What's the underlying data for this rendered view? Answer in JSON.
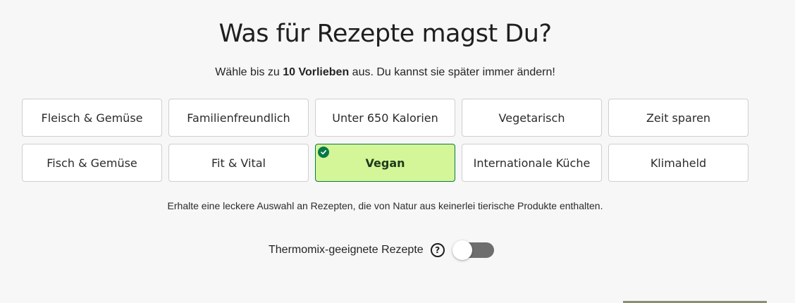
{
  "heading": "Was für Rezepte magst Du?",
  "subtitle": {
    "prefix": "Wähle bis zu ",
    "highlight": "10 Vorlieben",
    "suffix": " aus. Du kannst sie später immer ändern!"
  },
  "preferences": [
    {
      "label": "Fleisch & Gemüse",
      "selected": false
    },
    {
      "label": "Familienfreundlich",
      "selected": false
    },
    {
      "label": "Unter 650 Kalorien",
      "selected": false
    },
    {
      "label": "Vegetarisch",
      "selected": false
    },
    {
      "label": "Zeit sparen",
      "selected": false
    },
    {
      "label": "Fisch & Gemüse",
      "selected": false
    },
    {
      "label": "Fit & Vital",
      "selected": false
    },
    {
      "label": "Vegan",
      "selected": true
    },
    {
      "label": "Internationale Küche",
      "selected": false
    },
    {
      "label": "Klimaheld",
      "selected": false
    }
  ],
  "description": "Erhalte eine leckere Auswahl an Rezepten, die von Natur aus keinerlei tierische Produkte enthalten.",
  "thermomix": {
    "label": "Thermomix-geeignete Rezepte",
    "help_icon": "question-circle-icon",
    "help_glyph": "?",
    "enabled": false
  },
  "colors": {
    "selected_bg": "#d4f598",
    "selected_border": "#067a46",
    "toggle_off": "#6e6e6e"
  }
}
